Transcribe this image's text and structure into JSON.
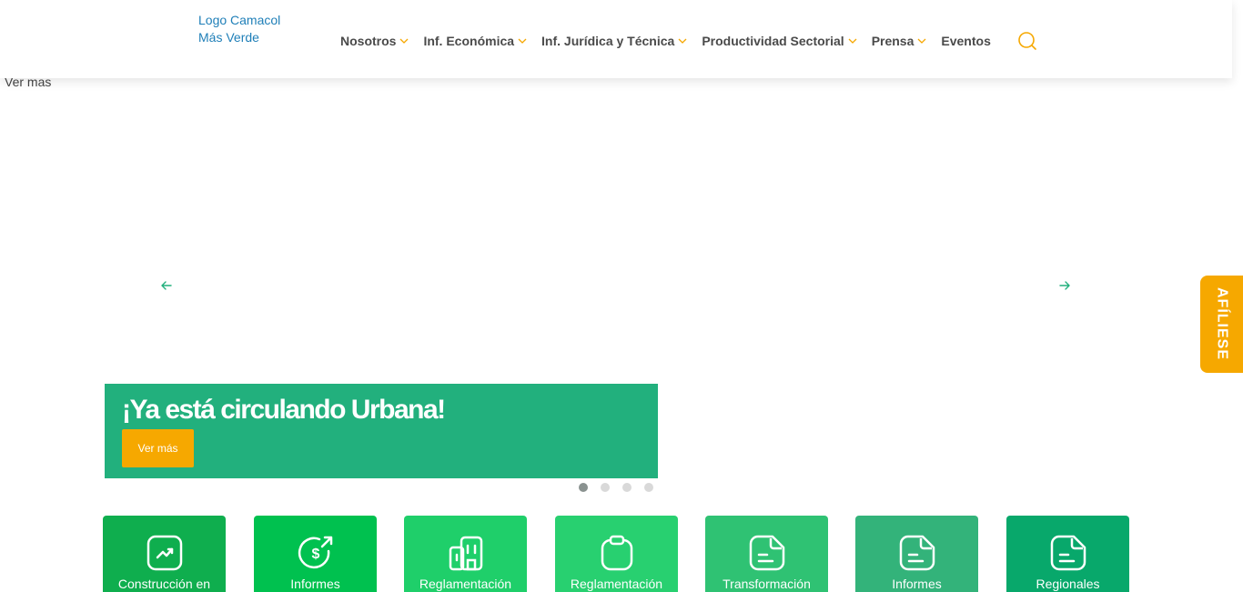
{
  "header": {
    "logo_line1": "Logo Camacol",
    "logo_line2": "Más Verde",
    "nav": [
      {
        "label": "Nosotros",
        "has_dropdown": true
      },
      {
        "label": "Inf. Económica",
        "has_dropdown": true
      },
      {
        "label": "Inf. Jurídica y Técnica",
        "has_dropdown": true
      },
      {
        "label": "Productividad Sectorial",
        "has_dropdown": true
      },
      {
        "label": "Prensa",
        "has_dropdown": true
      },
      {
        "label": "Eventos",
        "has_dropdown": false
      }
    ],
    "search_icon": "search-icon",
    "accent_color": "#f6a800"
  },
  "overlay_text": "Ver mas",
  "carousel": {
    "title": "¡Ya está circulando Urbana!",
    "button_label": "Ver más",
    "slide_count": 4,
    "active_slide": 1,
    "prev_icon": "arrow-left-icon",
    "next_icon": "arrow-right-icon",
    "banner_color": "#22b07d"
  },
  "side_tab": {
    "label": "AFÍLIESE",
    "color": "#f6a800"
  },
  "categories": [
    {
      "label": "Construcción en",
      "icon": "trend-chart-icon",
      "color": "#0fae4e"
    },
    {
      "label": "Informes",
      "icon": "dollar-circle-icon",
      "color": "#00c14f"
    },
    {
      "label": "Reglamentación",
      "icon": "buildings-icon",
      "color": "#1fcf6a"
    },
    {
      "label": "Reglamentación",
      "icon": "clipboard-icon",
      "color": "#28d070"
    },
    {
      "label": "Transformación",
      "icon": "document-icon",
      "color": "#2fc273"
    },
    {
      "label": "Informes",
      "icon": "document-icon",
      "color": "#33b37a"
    },
    {
      "label": "Regionales",
      "icon": "document-icon",
      "color": "#08a86b"
    }
  ]
}
